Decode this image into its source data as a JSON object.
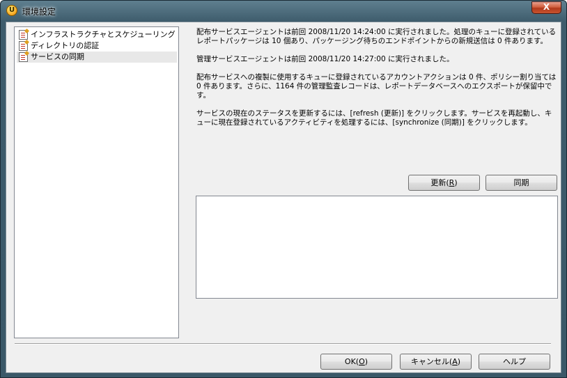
{
  "window": {
    "title": "環境設定",
    "close_label": "X"
  },
  "tree": {
    "items": [
      {
        "label": "インフラストラクチャとスケジューリング"
      },
      {
        "label": "ディレクトリの認証"
      },
      {
        "label": "サービスの同期",
        "selected": true
      }
    ]
  },
  "info": {
    "paragraphs": [
      "配布サービスエージェントは前回 2008/11/20 14:24:00 に実行されました。処理のキューに登録されているレポートパッケージは 10 個あり、パッケージング待ちのエンドポイントからの新規送信は 0 件あります。",
      "管理サービスエージェントは前回 2008/11/20 14:27:00 に実行されました。",
      "配布サービスへの複製に使用するキューに登録されているアカウントアクションは 0 件、ポリシー割り当ては 0 件あります。さらに、1164 件の管理監査レコードは、レポートデータベースへのエクスポートが保留中です。",
      "サービスの現在のステータスを更新するには、[refresh (更新)] をクリックします。サービスを再起動し、キューに現在登録されているアクティビティを処理するには、[synchronize (同期)] をクリックします。"
    ]
  },
  "actions": {
    "refresh_label": "更新(",
    "refresh_key": "R",
    "refresh_suffix": ")",
    "sync_label": "同期"
  },
  "log": {
    "content": ""
  },
  "footer": {
    "ok_label": "OK(",
    "ok_key": "O",
    "ok_suffix": ")",
    "cancel_label": "キャンセル(",
    "cancel_key": "A",
    "cancel_suffix": ")",
    "help_label": "ヘルプ"
  },
  "colors": {
    "frame": "#3e5c6c",
    "close_button": "#c9542f",
    "client_bg": "#f0f0f0"
  }
}
